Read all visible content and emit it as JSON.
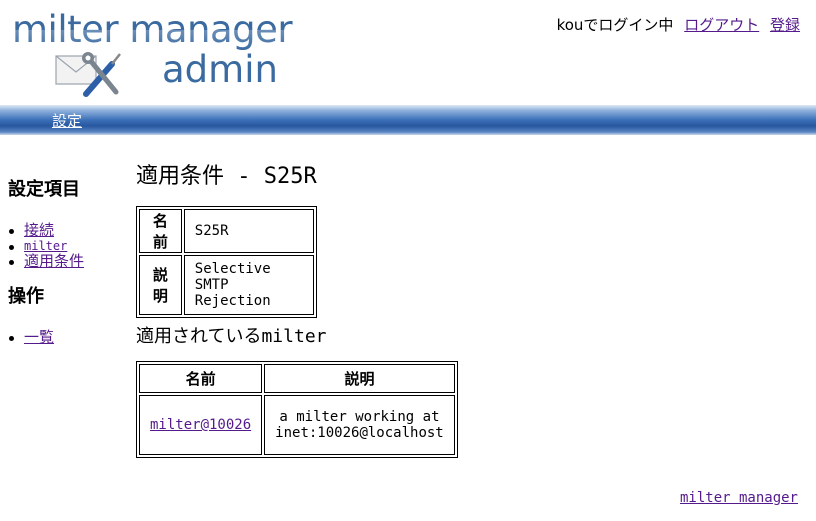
{
  "logo": {
    "line1": "milter manager",
    "line2": "admin"
  },
  "login": {
    "status": "kouでログイン中",
    "logout_label": "ログアウト",
    "register_label": "登録"
  },
  "nav": {
    "settings_label": "設定"
  },
  "sidebar": {
    "settings_heading": "設定項目",
    "settings_items": [
      {
        "label": "接続"
      },
      {
        "label": "milter"
      },
      {
        "label": "適用条件"
      }
    ],
    "ops_heading": "操作",
    "ops_items": [
      {
        "label": "一覧"
      }
    ]
  },
  "main": {
    "title_prefix": "適用条件",
    "title_sep": " - ",
    "title_name": "S25R",
    "info": {
      "name_label": "名前",
      "name_value": "S25R",
      "desc_label": "説明",
      "desc_value": "Selective SMTP Rejection"
    },
    "applied_heading_prefix": "適用されている",
    "applied_heading_suffix": "milter",
    "milter_table": {
      "headers": [
        "名前",
        "説明"
      ],
      "rows": [
        {
          "name": "milter@10026",
          "desc": "a milter working at inet:10026@localhost"
        }
      ]
    }
  },
  "footer": {
    "link_label": "milter manager"
  },
  "colors": {
    "logo_blue": "#3a6aa0",
    "nav_blue": "#27579e",
    "link_visited": "#551a8b"
  }
}
